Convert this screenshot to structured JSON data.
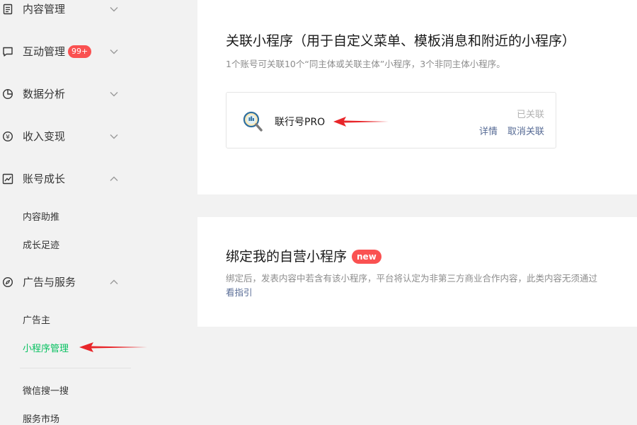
{
  "sidebar": {
    "items": [
      {
        "label": "内容管理",
        "icon": "document-icon",
        "expanded": false
      },
      {
        "label": "互动管理",
        "icon": "message-icon",
        "badge": "99+",
        "expanded": false
      },
      {
        "label": "数据分析",
        "icon": "pie-chart-icon",
        "expanded": false
      },
      {
        "label": "收入变现",
        "icon": "yen-icon",
        "expanded": false
      },
      {
        "label": "账号成长",
        "icon": "trend-chart-icon",
        "expanded": true
      },
      {
        "label": "广告与服务",
        "icon": "compass-icon",
        "expanded": true
      }
    ],
    "growth_subitems": [
      "内容助推",
      "成长足迹"
    ],
    "ads_subitems": [
      "广告主",
      "小程序管理"
    ],
    "extra_subitems": [
      "微信搜一搜",
      "服务市场"
    ],
    "active_item": "小程序管理"
  },
  "linked_section": {
    "title": "关联小程序（用于自定义菜单、模板消息和附近的小程序）",
    "description": "1个账号可关联10个“同主体或关联主体”小程序，3个非同主体小程序。",
    "program": {
      "name": "联行号PRO",
      "status": "已关联",
      "detail_label": "详情",
      "unlink_label": "取消关联"
    }
  },
  "bind_section": {
    "title": "绑定我的自营小程序",
    "badge": "new",
    "description": "绑定后，发表内容中若含有该小程序，平台将认定为非第三方商业合作内容，此类内容无须通过",
    "guide_link": "看指引"
  },
  "colors": {
    "accent_green": "#07c160",
    "badge_red": "#fa5151",
    "link_blue": "#576b95",
    "annotation_red": "#e8262a"
  }
}
